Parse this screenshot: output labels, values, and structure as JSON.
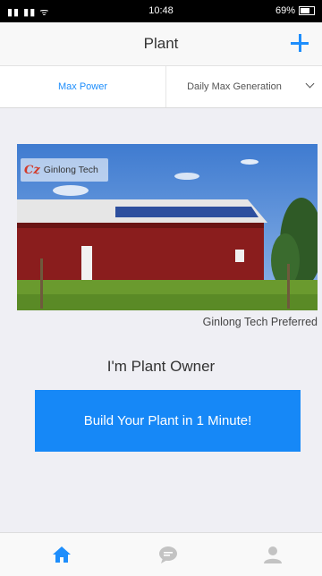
{
  "status_bar": {
    "signal_text": "31l 31l",
    "time": "10:48",
    "battery": "69%"
  },
  "nav": {
    "title": "Plant"
  },
  "tabs": {
    "max_power": "Max Power",
    "daily_max": "Daily Max Generation"
  },
  "banner": {
    "watermark_text": "Ginlong Tech",
    "caption": "Ginlong Tech Preferred"
  },
  "main": {
    "owner_label": "I'm Plant Owner",
    "build_button": "Build Your Plant in 1 Minute!"
  },
  "colors": {
    "accent": "#1e8efc",
    "button": "#1688f7",
    "icon_inactive": "#c3c3c3"
  },
  "icons": {
    "add": "plus-icon",
    "home": "home-icon",
    "chat": "chat-bubble-icon",
    "user": "user-icon"
  }
}
